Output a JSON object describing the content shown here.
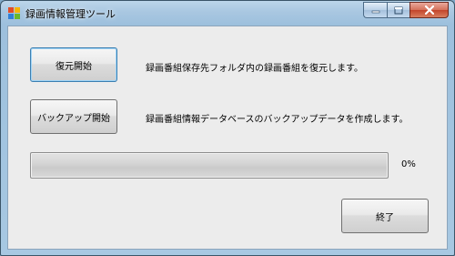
{
  "window": {
    "title": "録画情報管理ツール",
    "controls": {
      "minimize": "minimize-icon",
      "maximize": "maximize-icon",
      "close": "close-icon"
    }
  },
  "actions": {
    "restore_button": "復元開始",
    "restore_description": "録画番組保存先フォルダ内の録画番組を復元します。",
    "backup_button": "バックアップ開始",
    "backup_description": "録画番組情報データベースのバックアップデータを作成します。"
  },
  "progress": {
    "value": 0,
    "label": "0%"
  },
  "footer": {
    "exit_button": "終了"
  },
  "colors": {
    "progress_fill": "#37c30d",
    "default_button_border": "#3c7fb1",
    "close_button": "#c2442a"
  }
}
